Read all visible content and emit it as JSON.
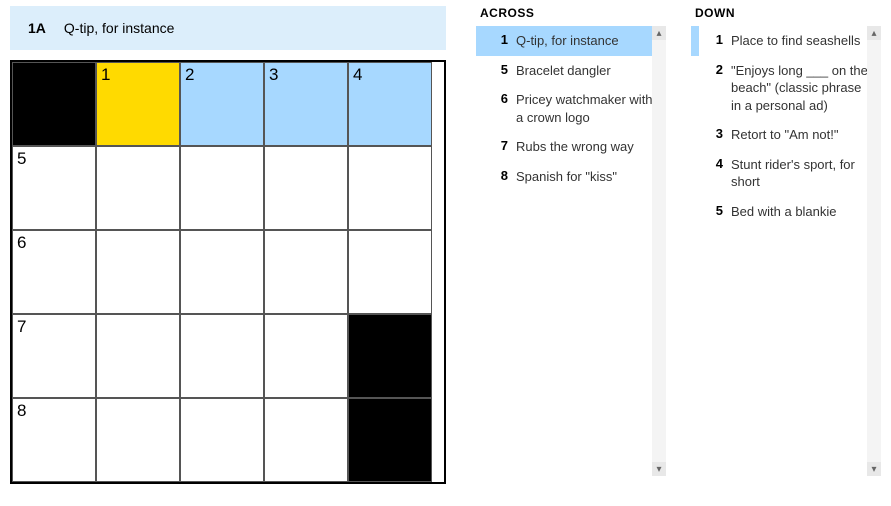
{
  "current_clue": {
    "label": "1A",
    "text": "Q-tip, for instance"
  },
  "grid": {
    "rows": [
      [
        {
          "black": true
        },
        {
          "num": "1",
          "active": true
        },
        {
          "num": "2",
          "highlight": true
        },
        {
          "num": "3",
          "highlight": true
        },
        {
          "num": "4",
          "highlight": true
        }
      ],
      [
        {
          "num": "5"
        },
        {},
        {},
        {},
        {}
      ],
      [
        {
          "num": "6"
        },
        {},
        {},
        {},
        {}
      ],
      [
        {
          "num": "7"
        },
        {},
        {},
        {},
        {
          "black": true
        }
      ],
      [
        {
          "num": "8"
        },
        {},
        {},
        {},
        {
          "black": true
        }
      ]
    ]
  },
  "across": {
    "header": "ACROSS",
    "clues": [
      {
        "num": "1",
        "text": "Q-tip, for instance",
        "selected": true
      },
      {
        "num": "5",
        "text": "Bracelet dangler"
      },
      {
        "num": "6",
        "text": "Pricey watchmaker with a crown logo"
      },
      {
        "num": "7",
        "text": "Rubs the wrong way"
      },
      {
        "num": "8",
        "text": "Spanish for \"kiss\""
      }
    ]
  },
  "down": {
    "header": "DOWN",
    "clues": [
      {
        "num": "1",
        "text": "Place to find seashells",
        "secondary": true
      },
      {
        "num": "2",
        "text": "\"Enjoys long ___ on the beach\" (classic phrase in a personal ad)"
      },
      {
        "num": "3",
        "text": "Retort to \"Am not!\""
      },
      {
        "num": "4",
        "text": "Stunt rider's sport, for short"
      },
      {
        "num": "5",
        "text": "Bed with a blankie"
      }
    ]
  },
  "scroll": {
    "up": "▴",
    "down": "▾"
  }
}
